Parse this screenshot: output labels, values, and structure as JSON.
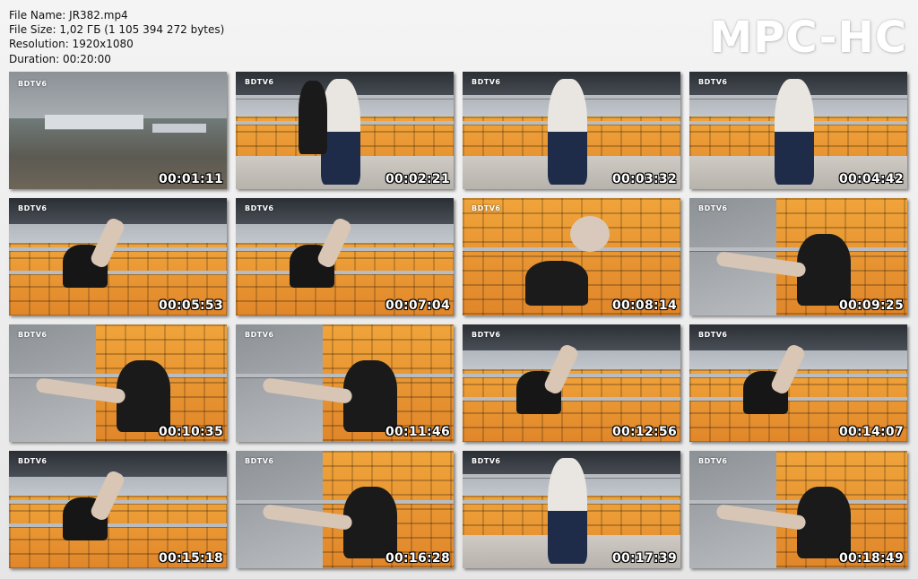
{
  "file_info": {
    "name_line": "File Name: JR382.mp4",
    "size_line": "File Size: 1,02 ГБ (1 105 394 272 bytes)",
    "resolution_line": "Resolution: 1920x1080",
    "duration_line": "Duration: 00:20:00"
  },
  "brand": "MPC-HC",
  "thumb_logo": "BDTV6",
  "thumbnails": [
    {
      "timestamp": "00:01:11",
      "scene": "aerial"
    },
    {
      "timestamp": "00:02:21",
      "scene": "stands-two-people"
    },
    {
      "timestamp": "00:03:32",
      "scene": "stands-man-leaning"
    },
    {
      "timestamp": "00:04:42",
      "scene": "stands-man-leaning"
    },
    {
      "timestamp": "00:05:53",
      "scene": "stands-low-angle"
    },
    {
      "timestamp": "00:07:04",
      "scene": "stands-low-angle"
    },
    {
      "timestamp": "00:08:14",
      "scene": "seats-closeup"
    },
    {
      "timestamp": "00:09:25",
      "scene": "seated-angle"
    },
    {
      "timestamp": "00:10:35",
      "scene": "seated-angle"
    },
    {
      "timestamp": "00:11:46",
      "scene": "seated-angle"
    },
    {
      "timestamp": "00:12:56",
      "scene": "stands-low-angle"
    },
    {
      "timestamp": "00:14:07",
      "scene": "stands-low-angle"
    },
    {
      "timestamp": "00:15:18",
      "scene": "stands-low-angle"
    },
    {
      "timestamp": "00:16:28",
      "scene": "seated-angle"
    },
    {
      "timestamp": "00:17:39",
      "scene": "stands-man-leaning"
    },
    {
      "timestamp": "00:18:49",
      "scene": "seated-angle"
    }
  ]
}
